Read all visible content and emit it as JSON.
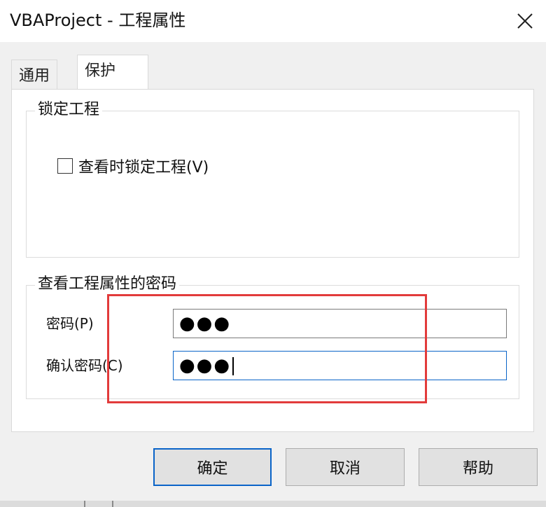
{
  "window": {
    "title": "VBAProject - 工程属性",
    "close_glyph": "✕"
  },
  "tabs": [
    {
      "label": "通用",
      "active": false
    },
    {
      "label": "保护",
      "active": true
    }
  ],
  "lock_group": {
    "legend": "锁定工程",
    "checkbox_label": "查看时锁定工程(V)",
    "checked": false
  },
  "password_group": {
    "legend": "查看工程属性的密码",
    "password_label": "密码(P)",
    "password_value": "●●●",
    "confirm_label": "确认密码(C)",
    "confirm_value": "●●●"
  },
  "buttons": {
    "ok": "确定",
    "cancel": "取消",
    "help": "帮助"
  },
  "colors": {
    "highlight": "#e23b3b",
    "focus": "#0a64c8"
  }
}
